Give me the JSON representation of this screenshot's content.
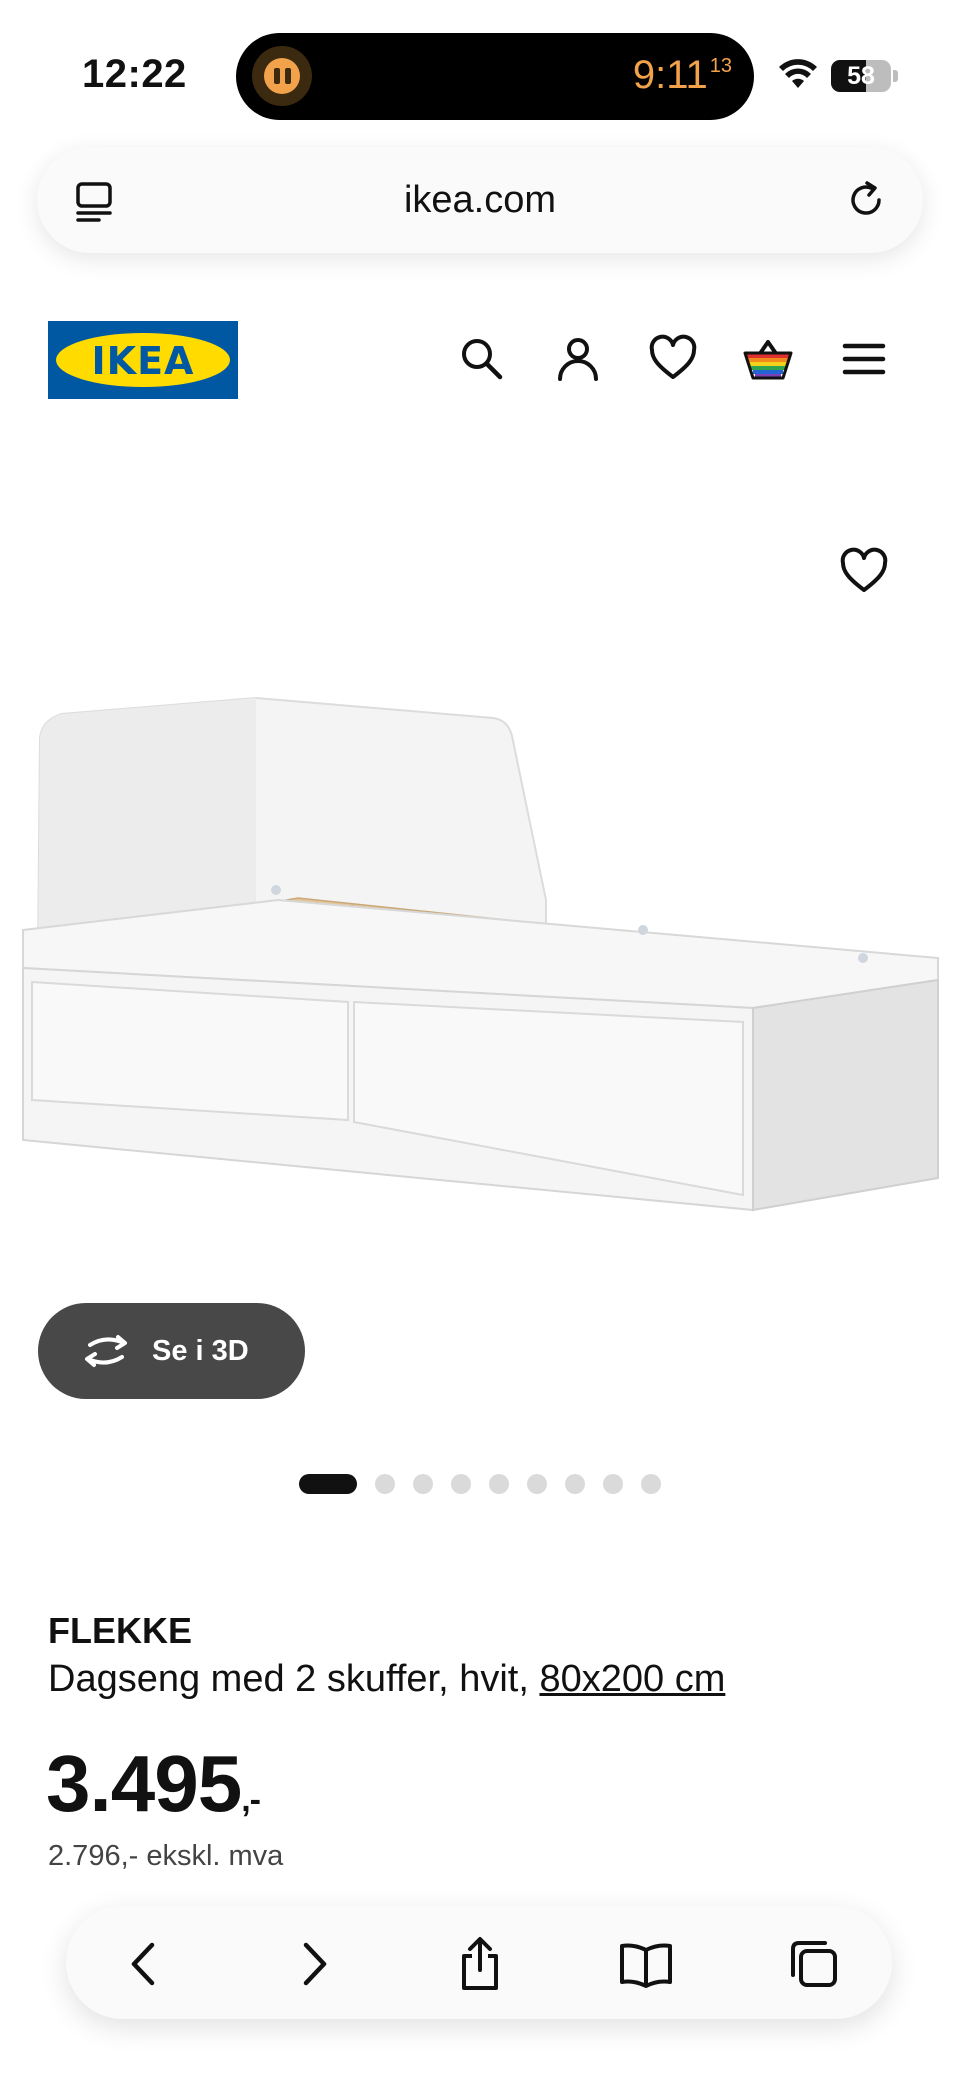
{
  "status_bar": {
    "time": "12:22",
    "timer_main": "9:11",
    "timer_seconds": "13",
    "battery_level": "58",
    "battery_fraction": 0.58
  },
  "browser": {
    "url": "ikea.com"
  },
  "header": {
    "logo_text": "IKEA",
    "icons": [
      "search-icon",
      "account-icon",
      "wishlist-icon",
      "shopping-bag-icon",
      "menu-icon"
    ]
  },
  "product": {
    "view_3d_label": "Se i 3D",
    "gallery_total_images": 9,
    "gallery_active_index": 0,
    "name": "FLEKKE",
    "description": "Dagseng med 2 skuffer, hvit,",
    "size_link": "80x200 cm",
    "price_main": "3.495",
    "price_suffix": ",-",
    "price_ex_vat": "2.796,- ekskl. mva"
  },
  "toolbar": {
    "buttons": [
      "back-icon",
      "forward-icon",
      "share-icon",
      "bookmarks-icon",
      "tabs-icon"
    ]
  },
  "colors": {
    "ikea_blue": "#0058a3",
    "ikea_yellow": "#ffdb00",
    "timer_orange": "#f2a24a",
    "button_dark": "#484848"
  }
}
